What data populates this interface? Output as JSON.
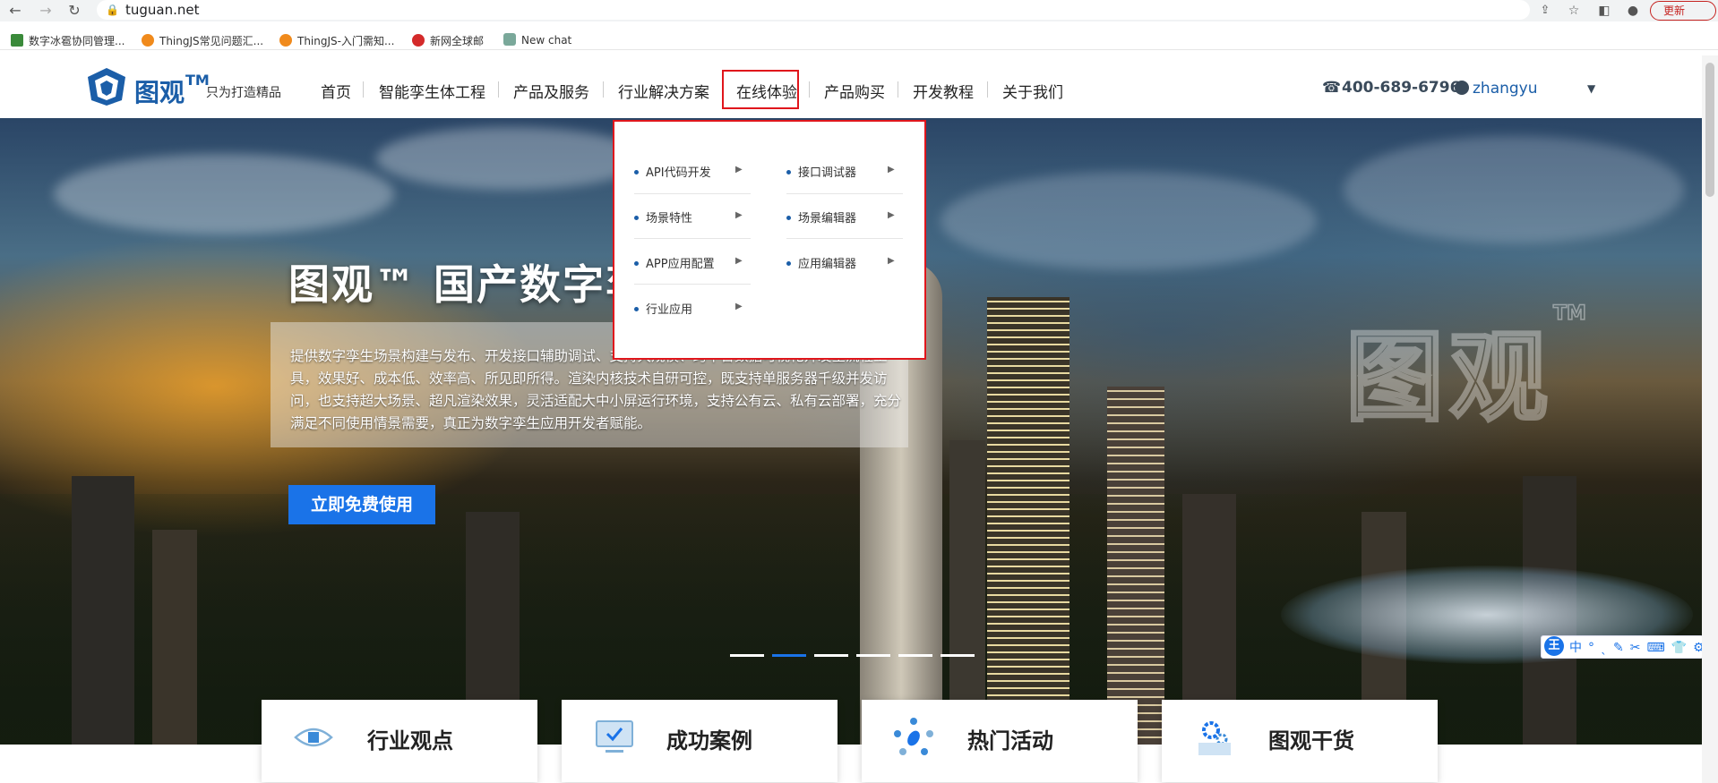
{
  "browser": {
    "url": "tuguan.net",
    "update_label": "更新",
    "bookmarks": [
      "数字冰雹协同管理...",
      "ThingJS常见问题汇...",
      "ThingJS-入门需知...",
      "新网全球邮",
      "New chat"
    ]
  },
  "header": {
    "logo_text": "图观",
    "logo_tm": "TM",
    "slogan": "只为打造精品",
    "nav": [
      "首页",
      "智能孪生体工程",
      "产品及服务",
      "行业解决方案",
      "在线体验",
      "产品购买",
      "开发教程",
      "关于我们"
    ],
    "phone": "400-689-6796",
    "username": "zhangyu"
  },
  "dropdown": {
    "left": [
      "API代码开发",
      "场景特性",
      "APP应用配置",
      "行业应用"
    ],
    "right": [
      "接口调试器",
      "场景编辑器",
      "应用编辑器"
    ]
  },
  "hero": {
    "title": "图观™ 国产数字孪",
    "description": "提供数字孪生场景构建与发布、开发接口辅助调试、支持大规模、跨平台数据可视化开发全流程工具，效果好、成本低、效率高、所见即所得。渲染内核技术自研可控，既支持单服务器千级并发访问，也支持超大场景、超凡渲染效果，灵活适配大中小屏运行环境，支持公有云、私有云部署，充分满足不同使用情景需要，真正为数字孪生应用开发者赋能。",
    "cta": "立即免费使用",
    "watermark": "图观",
    "watermark_tm": "TM",
    "slides_total": 6,
    "slide_active": 2
  },
  "cards": [
    "行业观点",
    "成功案例",
    "热门活动",
    "图观干货"
  ],
  "ime": {
    "logo": "王",
    "tools": "中°ˎ✎✂⌨👕⚙"
  },
  "colors": {
    "brand": "#1b5ea8",
    "accent": "#1a73e8",
    "highlight": "#e0161c"
  }
}
